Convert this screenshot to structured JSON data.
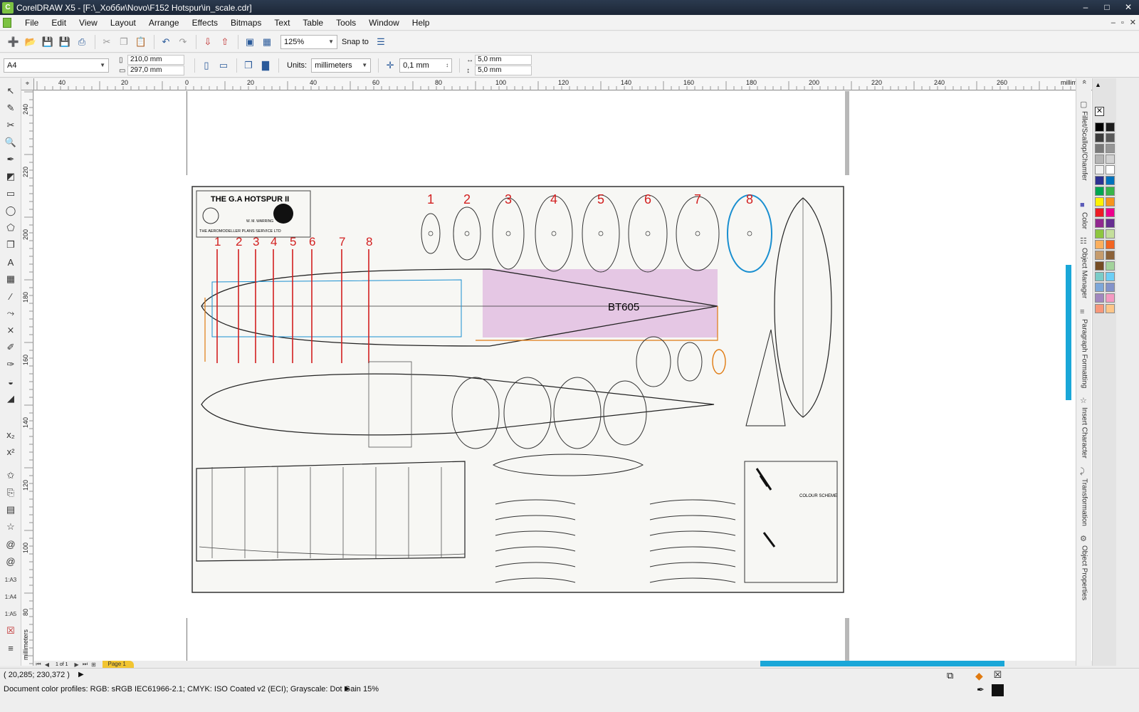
{
  "window": {
    "title": "CorelDRAW X5 - [F:\\_Хобби\\Novo\\F152 Hotspur\\in_scale.cdr]",
    "logo_letter": "C",
    "controls": [
      "–",
      "□",
      "✕"
    ]
  },
  "menu": {
    "items": [
      "File",
      "Edit",
      "View",
      "Layout",
      "Arrange",
      "Effects",
      "Bitmaps",
      "Text",
      "Table",
      "Tools",
      "Window",
      "Help"
    ],
    "doc_controls": [
      "–",
      "▫",
      "✕"
    ]
  },
  "toolbar": {
    "zoom": "125%",
    "snap_to": "Snap to"
  },
  "propbar": {
    "page_size": "A4",
    "width": "210,0 mm",
    "height": "297,0 mm",
    "units_label": "Units:",
    "units": "millimeters",
    "nudge": "0,1 mm",
    "dup_x": "5,0 mm",
    "dup_y": "5,0 mm"
  },
  "ruler": {
    "h_labels": [
      "40",
      "20",
      "0",
      "20",
      "40",
      "60",
      "80",
      "100",
      "120",
      "140",
      "160",
      "180",
      "200",
      "220",
      "240",
      "260"
    ],
    "h_unit": "millimeters",
    "v_labels": [
      "240",
      "220",
      "200",
      "180",
      "160",
      "140",
      "120",
      "100",
      "80"
    ],
    "v_unit": "millimeters"
  },
  "blueprint": {
    "title": "THE G.A HOTSPUR II",
    "subtitle": "THE AEROMODELLER PLANS SERVICE LTD",
    "designer": "W. M. WARRING",
    "serial": "BT605",
    "colour_scheme": "COLOUR SCHEME",
    "former_numbers_top": [
      "1",
      "2",
      "3",
      "4",
      "5",
      "6",
      "7",
      "8"
    ],
    "former_numbers_side": [
      "1",
      "2",
      "3",
      "4",
      "5",
      "6",
      "7",
      "8"
    ]
  },
  "pagebar": {
    "page_count": "1 of 1",
    "page_tab": "Page 1"
  },
  "docker": {
    "tabs": [
      "Fillet/Scallop/Chamfer",
      "Color",
      "Object Manager",
      "Paragraph Formatting",
      "Insert Character",
      "Transformation",
      "Object Properties"
    ]
  },
  "status": {
    "coords": "( 20,285; 230,372 )",
    "profile": "Document color profiles: RGB: sRGB IEC61966-2.1; CMYK: ISO Coated v2 (ECI); Grayscale: Dot Gain 15%"
  },
  "colors": {
    "accent": "#1aa7d8",
    "page_tab": "#f2c531",
    "highlight": "#d9a6d9",
    "former_red": "#d21f1f",
    "former_blue": "#1a8fd0",
    "former_orange": "#e07a10"
  },
  "palette": [
    "#000000",
    "#1e1e1e",
    "#3c3c3c",
    "#5a5a5a",
    "#787878",
    "#969696",
    "#b4b4b4",
    "#d2d2d2",
    "#f0f0f0",
    "#ffffff",
    "#2e3192",
    "#0072bc",
    "#00a651",
    "#39b54a",
    "#fff200",
    "#f7941d",
    "#ed1c24",
    "#ec008c",
    "#92278f",
    "#662d91",
    "#8dc63f",
    "#c4df9b",
    "#fbaf5d",
    "#f26522",
    "#c69c6d",
    "#8c6239",
    "#754c24",
    "#a3d39c",
    "#7accc8",
    "#6dcff6",
    "#7da7d9",
    "#8393ca",
    "#a187be",
    "#f49ac2",
    "#f7977a",
    "#fdc689"
  ]
}
